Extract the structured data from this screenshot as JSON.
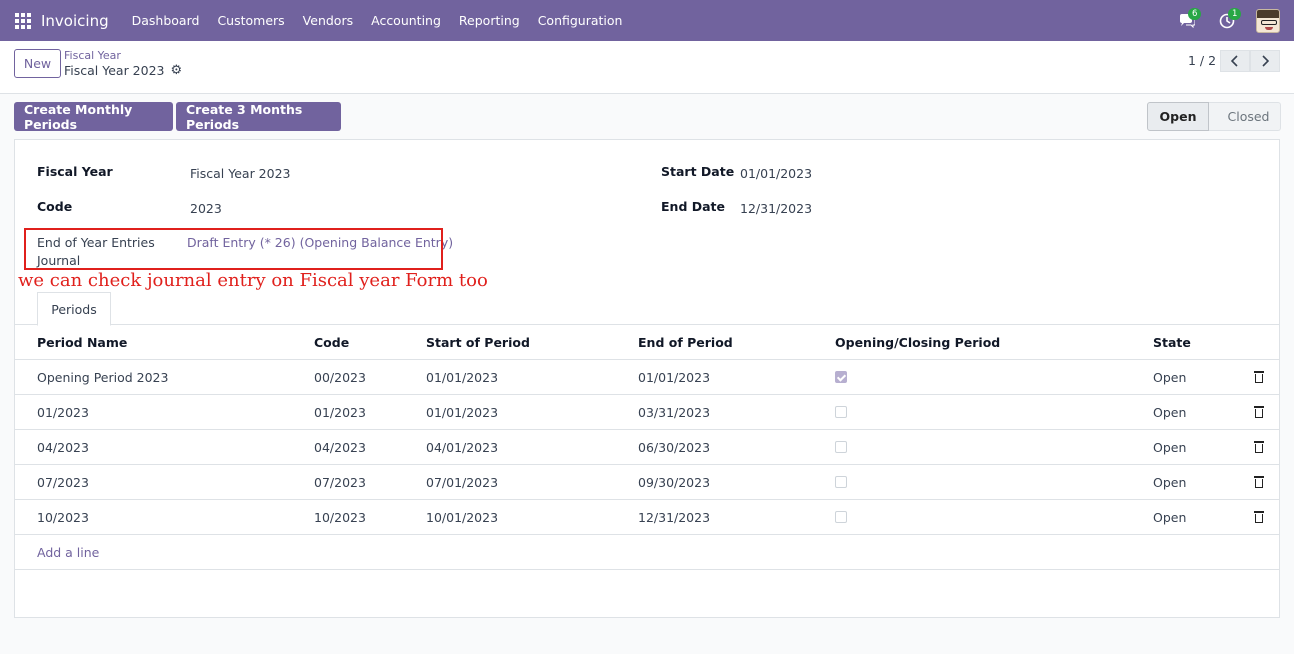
{
  "navbar": {
    "app_name": "Invoicing",
    "menu": [
      "Dashboard",
      "Customers",
      "Vendors",
      "Accounting",
      "Reporting",
      "Configuration"
    ],
    "messages_count": "6",
    "activities_count": "1",
    "accent_color": "#71639e"
  },
  "control_panel": {
    "new_label": "New",
    "breadcrumb_parent": "Fiscal Year",
    "breadcrumb_current": "Fiscal Year 2023",
    "pager": "1 / 2"
  },
  "actions": {
    "monthly": "Create Monthly Periods",
    "quarterly": "Create 3 Months Periods"
  },
  "statusbar": {
    "open": "Open",
    "closed": "Closed"
  },
  "form": {
    "fiscal_year_label": "Fiscal Year",
    "fiscal_year_value": "Fiscal Year 2023",
    "code_label": "Code",
    "code_value": "2023",
    "start_date_label": "Start Date",
    "start_date_value": "01/01/2023",
    "end_date_label": "End Date",
    "end_date_value": "12/31/2023",
    "journal_label_line1": "End of Year Entries",
    "journal_label_line2": "Journal",
    "journal_value": "Draft Entry (* 26) (Opening Balance Entry)"
  },
  "annotation": "we can check journal entry on Fiscal year Form too",
  "tabs": {
    "periods": "Periods"
  },
  "table": {
    "headers": [
      "Period Name",
      "Code",
      "Start of Period",
      "End of Period",
      "Opening/Closing Period",
      "State"
    ],
    "rows": [
      {
        "name": "Opening Period 2023",
        "code": "00/2023",
        "start": "01/01/2023",
        "end": "01/01/2023",
        "opening": true,
        "state": "Open"
      },
      {
        "name": "01/2023",
        "code": "01/2023",
        "start": "01/01/2023",
        "end": "03/31/2023",
        "opening": false,
        "state": "Open"
      },
      {
        "name": "04/2023",
        "code": "04/2023",
        "start": "04/01/2023",
        "end": "06/30/2023",
        "opening": false,
        "state": "Open"
      },
      {
        "name": "07/2023",
        "code": "07/2023",
        "start": "07/01/2023",
        "end": "09/30/2023",
        "opening": false,
        "state": "Open"
      },
      {
        "name": "10/2023",
        "code": "10/2023",
        "start": "10/01/2023",
        "end": "12/31/2023",
        "opening": false,
        "state": "Open"
      }
    ],
    "add_line": "Add a line"
  }
}
